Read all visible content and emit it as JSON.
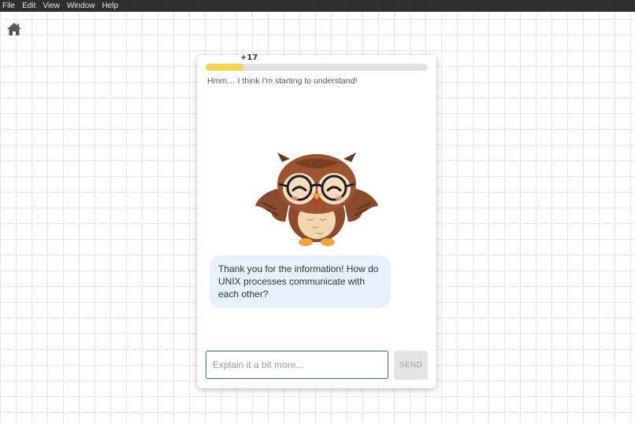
{
  "menubar": {
    "items": [
      "File",
      "Edit",
      "View",
      "Window",
      "Help"
    ]
  },
  "icons": {
    "home": "home-icon",
    "mascot": "owl-icon"
  },
  "progress": {
    "xp_gain": "+17",
    "fraction": 0.17,
    "fill_color": "#f7d44c"
  },
  "status": {
    "text": "Hmm… I think I'm starting to understand!"
  },
  "chat": {
    "message": "Thank you for the information! How do UNIX processes communicate with each other?"
  },
  "input": {
    "placeholder": "Explain it a bit more...",
    "value": ""
  },
  "send": {
    "label": "SEND"
  }
}
